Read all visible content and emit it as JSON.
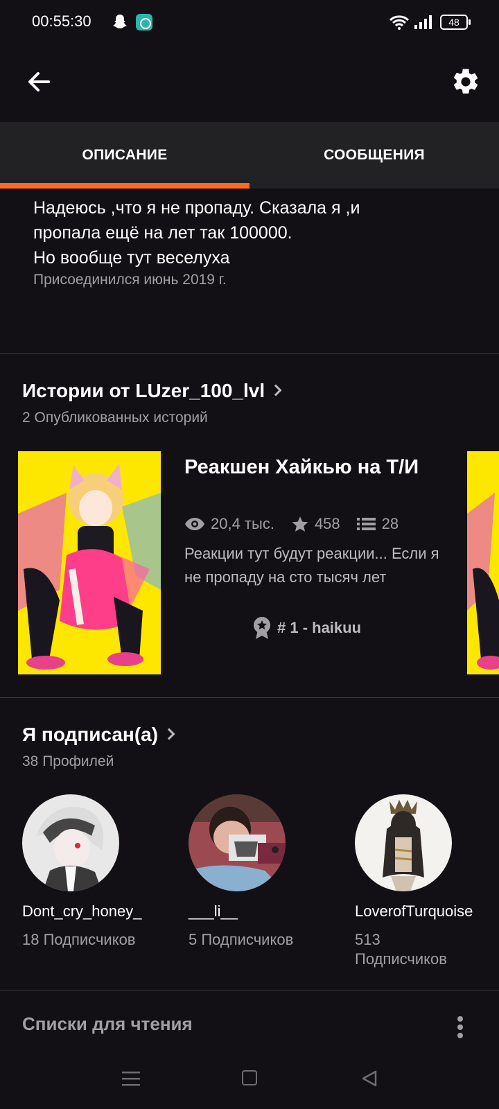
{
  "status_bar": {
    "time": "00:55:30",
    "battery": "48"
  },
  "tabs": {
    "description": "ОПИСАНИЕ",
    "messages": "СООБЩЕНИЯ"
  },
  "accent_color": "#ff6a1f",
  "description": {
    "lines": [
      "Надеюсь ,что я не пропаду. Сказала я ,и",
      "пропала ещё на лет так 100000.",
      "Но вообще тут веселуха"
    ],
    "joined": "Присоединился июнь 2019 г."
  },
  "stories": {
    "title": "Истории от LUzer_100_lvl",
    "count": "2 Опубликованных историй",
    "items": [
      {
        "title": "Реакшен  Хайкью на Т/И",
        "reads": "20,4 тыс.",
        "votes": "458",
        "parts": "28",
        "desc": "Реакции тут будут реакции... Если я не пропаду на сто тысяч лет",
        "rank": "# 1 - haikuu"
      }
    ]
  },
  "following": {
    "title": "Я подписан(а)",
    "count": "38 Профилей",
    "profiles": [
      {
        "name": "Dont_cry_honey_",
        "followers": "18 Подписчиков"
      },
      {
        "name": "___li__",
        "followers": "5 Подписчиков"
      },
      {
        "name": "LoverofTurquoise",
        "followers": "513 Подписчиков"
      }
    ]
  },
  "reading_lists": {
    "title": "Списки для чтения"
  },
  "icons": {
    "back": "arrow-left-icon",
    "settings": "gear-icon",
    "reads": "eye-icon",
    "votes": "star-icon",
    "parts": "list-icon",
    "rank": "ribbon-badge-icon",
    "more": "more-vertical-icon"
  }
}
